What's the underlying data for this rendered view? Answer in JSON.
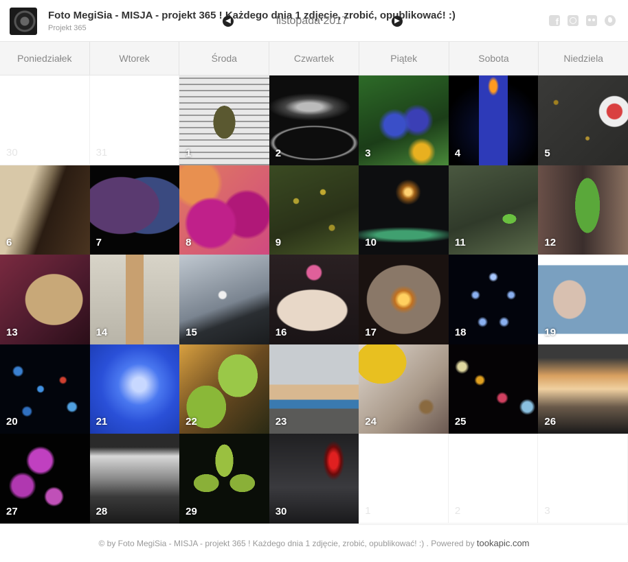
{
  "header": {
    "title": "Foto MegiSia - MISJA - projekt 365 ! Każdego dnia 1 zdjęcie, zrobić, opublikować! :)",
    "subtitle": "Projekt 365",
    "month": "listopada 2017",
    "prev_icon": "arrow-left-icon",
    "next_icon": "arrow-right-icon",
    "social": [
      "facebook-icon",
      "instagram-icon",
      "flickr-icon",
      "globe-icon"
    ]
  },
  "weekdays": [
    "Poniedziałek",
    "Wtorek",
    "Środa",
    "Czwartek",
    "Piątek",
    "Sobota",
    "Niedziela"
  ],
  "days": [
    {
      "n": "30",
      "empty": true
    },
    {
      "n": "31",
      "empty": true
    },
    {
      "n": "1",
      "bg": "repeating-linear-gradient(0deg,#999 0 2px,#e8e8e8 2px 9px),repeating-linear-gradient(90deg,#999 0 2px,#e8e8e8 2px 9px)",
      "bg2": "radial-gradient(ellipse 16px 24px at 50% 52%,#5a5830 0 100%,transparent 100%)"
    },
    {
      "n": "2",
      "bg": "radial-gradient(ellipse 60px 20px at 45% 35%,#bbb 0 30%,#444 60%,#0d0d0d 100%)",
      "bg2": "radial-gradient(ellipse 70px 28px at 50% 75%,transparent 0 80%,#999 85%,transparent 92%)"
    },
    {
      "n": "3",
      "bg": "radial-gradient(circle at 40% 55%,#3a4fc8 0 14%,transparent 22%),radial-gradient(circle at 65% 50%,#3b3fb5 0 14%,transparent 22%),radial-gradient(circle at 70% 85%,#e8b020 0 8%,transparent 14%),linear-gradient(160deg,#2d6b28,#1b3d18 60%,#4a8a3a)"
    },
    {
      "n": "4",
      "bg": "radial-gradient(ellipse 8px 14px at 50% 12%,#ff9a20 0 60%,transparent 100%),linear-gradient(90deg,transparent 0 34%,#2d3ab8 34% 66%,transparent 66%),radial-gradient(circle at 50% 60%,#0a1240,#000 70%)"
    },
    {
      "n": "5",
      "bg": "radial-gradient(circle at 85% 40%,#d94040 0 8%,#eee 9% 16%,transparent 17%),radial-gradient(circle at 20% 30%,#a08020 0 2%,transparent 3%),radial-gradient(circle at 55% 70%,#b09030 0 2%,transparent 3%),linear-gradient(135deg,#3a3a38,#2a2a28)"
    },
    {
      "n": "6",
      "bg": "linear-gradient(110deg,#d8c8a8 0 30%,#7a6a50 45%,#2a1c12 55%,#4a3420 100%)"
    },
    {
      "n": "7",
      "bg": "radial-gradient(ellipse 60% 45% at 35% 45%,#5a3a70 0 70%,transparent 72%),radial-gradient(ellipse 60% 45% at 65% 45%,#3a4a80 0 70%,transparent 72%),#050505"
    },
    {
      "n": "8",
      "bg": "radial-gradient(circle at 35% 65%,#c0208a 0 28%,transparent 32%),radial-gradient(circle at 75% 55%,#b01878 0 26%,transparent 30%),radial-gradient(circle at 20% 20%,#e89050 0 20%,transparent 25%),linear-gradient(135deg,#e07a60,#d04a80)"
    },
    {
      "n": "9",
      "bg": "radial-gradient(circle at 30% 40%,#b0a030 0 3%,transparent 4%),radial-gradient(circle at 60% 30%,#c0a830 0 3%,transparent 4%),radial-gradient(circle at 70% 70%,#a09028 0 3%,transparent 4%),linear-gradient(160deg,#3a4a22,#2a3218 60%,#4a5a28)"
    },
    {
      "n": "10",
      "bg": "radial-gradient(circle at 55% 30%,#ffd070 0 4%,#a06018 8%,transparent 16%),radial-gradient(ellipse 100% 15% at 50% 78%,#40a070 0 30%,transparent 60%),#0d0e10"
    },
    {
      "n": "11",
      "bg": "radial-gradient(ellipse 10px 7px at 68% 60%,#6ac040 0 100%,transparent 100%),linear-gradient(160deg,#4a5840,#303a2a 55%,#5a6a4a)"
    },
    {
      "n": "12",
      "bg": "radial-gradient(ellipse 18px 40px at 55% 45%,#5aa83a 0 100%,transparent 100%),linear-gradient(90deg,#6a5048,#3a2e2c 50%,#8a7060)"
    },
    {
      "n": "13",
      "bg": "radial-gradient(ellipse 45% 40% at 60% 50%,#c8a878 0 70%,transparent 72%),linear-gradient(135deg,#7a2a40,#4a1a2c 60%,#2a0e18)"
    },
    {
      "n": "14",
      "bg": "linear-gradient(90deg,transparent 0 40%,#c8a070 40% 60%,transparent 60%),radial-gradient(ellipse 12px 20px at 50% 32%,#1a1a20 0 100%,transparent 100%),linear-gradient(180deg,#d8d4c8,#b8b4a8)"
    },
    {
      "n": "15",
      "bg": "radial-gradient(circle at 48% 45%,#f0f0f0 0 5%,transparent 7%),linear-gradient(160deg,#c0c8d0,#7a8490 55%,#2a2e32 70%,#1a1c1e)"
    },
    {
      "n": "16",
      "bg": "radial-gradient(ellipse 48% 28% at 48% 62%,#e8d8c8 0 80%,transparent 84%),radial-gradient(circle at 50% 20%,#e0609a 0 8%,transparent 10%),linear-gradient(180deg,#2a2022,#1a1416)"
    },
    {
      "n": "17",
      "bg": "radial-gradient(circle at 50% 50%,#ffd060 0 8%,#c07020 14%,transparent 22%),radial-gradient(ellipse 45% 42% at 50% 50%,#8a7868 0 90%,transparent 92%),#1a1210"
    },
    {
      "n": "18",
      "bg": "radial-gradient(circle at 50% 25%,#a8c8ff 0 3%,transparent 6%),radial-gradient(circle at 30% 45%,#8ab0f0 0 3%,transparent 6%),radial-gradient(circle at 70% 45%,#8ab0f0 0 3%,transparent 6%),radial-gradient(circle at 38% 75%,#8ab0f0 0 3%,transparent 6%),radial-gradient(circle at 62% 75%,#8ab0f0 0 3%,transparent 6%),#02040c"
    },
    {
      "n": "19",
      "bg": "radial-gradient(ellipse 22% 26% at 35% 50%,#d8c0b0 0 80%,transparent 85%),linear-gradient(180deg,#fff 0 12%,#7aa0c0 12% 88%,#fff 88%)"
    },
    {
      "n": "20",
      "bg": "radial-gradient(circle at 20% 30%,#3a80d0 0 4%,transparent 6%),radial-gradient(circle at 45% 50%,#4090e0 0 4%,transparent 6%),radial-gradient(circle at 70% 40%,#d04030 0 3%,transparent 5%),radial-gradient(circle at 30% 75%,#3070c0 0 4%,transparent 6%),radial-gradient(circle at 80% 70%,#50a0e0 0 4%,transparent 6%),#02050c"
    },
    {
      "n": "21",
      "bg": "radial-gradient(circle at 55% 45%,#c8d8ff 0 10%,#4a78f0 30%,#2a50d8 55%,#1a3ab0 100%)"
    },
    {
      "n": "22",
      "bg": "radial-gradient(ellipse 22% 24% at 30% 70%,#8ab838 0 100%,transparent 100%),radial-gradient(ellipse 22% 24% at 65% 35%,#9ac848 0 100%,transparent 100%),linear-gradient(135deg,#d8a040,#6a4a20 50%,#2a2a14)"
    },
    {
      "n": "23",
      "bg": "linear-gradient(180deg,#c8ccd0 0 45%,#d8b890 45% 62%,#3a7ab0 62% 72%,#5a5a58 72%)"
    },
    {
      "n": "24",
      "bg": "radial-gradient(ellipse 28% 24% at 25% 20%,#e8c020 0 100%,transparent 100%),radial-gradient(circle at 75% 70%,#8a6a40 0 6%,transparent 9%),linear-gradient(135deg,#e0d8d0,#a89888 60%,#6a5850)"
    },
    {
      "n": "25",
      "bg": "radial-gradient(circle at 15% 25%,#e0d8a0 0 4%,transparent 7%),radial-gradient(circle at 35% 40%,#e0a020 0 4%,transparent 7%),radial-gradient(circle at 60% 60%,#d04060 0 5%,transparent 8%),radial-gradient(circle at 88% 70%,#8ac0e0 0 5%,transparent 8%),#050305"
    },
    {
      "n": "26",
      "bg": "linear-gradient(180deg,#3a3a3a 0 15%,#d8a060 35%,#f0d0a0 50%,#6a5a4a 70%,#1a1a1a 100%)"
    },
    {
      "n": "27",
      "bg": "radial-gradient(circle at 45% 30%,#c040c0 0 14%,transparent 18%),radial-gradient(circle at 25% 58%,#b038b0 0 12%,transparent 16%),radial-gradient(circle at 60% 70%,#c050b8 0 9%,transparent 12%),#020202"
    },
    {
      "n": "28",
      "bg": "linear-gradient(180deg,#2a2a2a 0 15%,#d8d8d8 25%,#8a8a8a 50%,#3a3a3a 70%,#1a1a1a 100%)"
    },
    {
      "n": "29",
      "bg": "radial-gradient(ellipse 10% 18% at 50% 30%,#9ac040 0 100%,transparent 100%),radial-gradient(ellipse 14% 10% at 30% 55%,#8ab038 0 100%,transparent 100%),radial-gradient(ellipse 14% 10% at 70% 55%,#8ab038 0 100%,transparent 100%),#0a0e08"
    },
    {
      "n": "30",
      "bg": "radial-gradient(ellipse 12% 22% at 72% 30%,#e02020 0 40%,#6a0a0a 70%,transparent 100%),linear-gradient(180deg,#202022,#3a3a3e 60%,#1a1a1c)"
    },
    {
      "n": "1",
      "empty": true
    },
    {
      "n": "2",
      "empty": true
    },
    {
      "n": "3",
      "empty": true
    }
  ],
  "footer": {
    "text": "© by Foto MegiSia - MISJA - projekt 365 ! Każdego dnia 1 zdjęcie, zrobić, opublikować! :) . Powered by ",
    "link": "tookapic.com"
  }
}
